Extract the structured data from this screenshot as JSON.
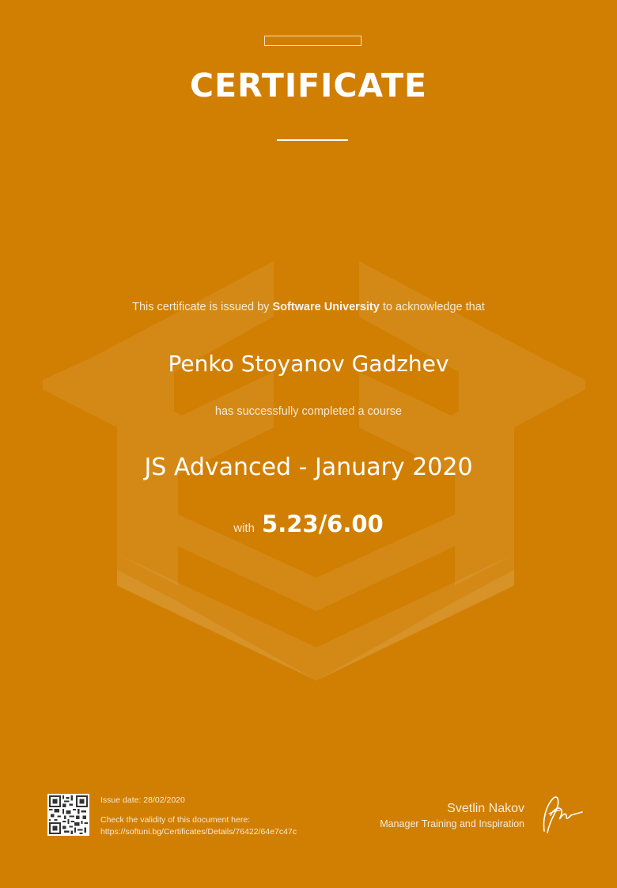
{
  "certificate": {
    "title": "CERTIFICATE",
    "issued_prefix": "This certificate is issued by ",
    "issuer": "Software University",
    "issued_suffix": " to acknowledge that",
    "recipient_name": "Penko Stoyanov Gadzhev",
    "completed_text": "has successfully completed a course",
    "course_name": "JS Advanced - January 2020",
    "grade_prefix": "with",
    "grade": "5.23/6.00"
  },
  "footer": {
    "issue_date": "Issue date: 28/02/2020",
    "check_text": "Check the validity of this document here:",
    "verify_url": "https://softuni.bg/Certificates/Details/76422/64e7c47c",
    "signer_name": "Svetlin Nakov",
    "signer_role": "Manager Training and Inspiration"
  },
  "colors": {
    "background": "#D17F03",
    "text": "#FFFFFF"
  },
  "icons": {
    "qr": "qr-code-icon",
    "watermark": "softuni-logo-watermark",
    "signature": "signature-mark"
  }
}
